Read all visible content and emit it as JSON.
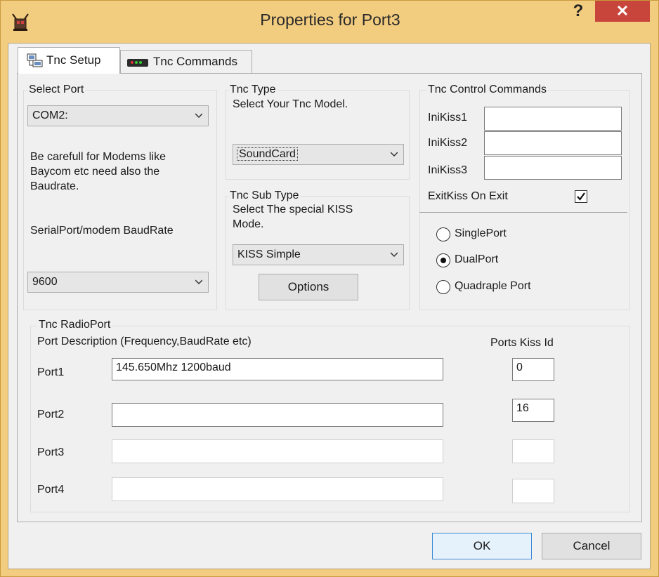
{
  "window": {
    "title": "Properties for Port3",
    "help_label": "?",
    "close_label": "✕",
    "frame_color": "#f2cc7f",
    "close_color": "#c7453b"
  },
  "tabs": [
    {
      "label": "Tnc Setup",
      "icon": "network-settings-icon",
      "selected": true
    },
    {
      "label": "Tnc Commands",
      "icon": "tnc-device-icon",
      "selected": false
    }
  ],
  "select_port": {
    "legend": "Select Port",
    "port_value": "COM2:",
    "note": [
      "Be carefull for Modems like",
      "Baycom etc need also the",
      "Baudrate."
    ],
    "baud_label": "SerialPort/modem BaudRate",
    "baud_value": "9600"
  },
  "tnc_type": {
    "legend": "Tnc Type",
    "prompt": "Select Your Tnc Model.",
    "value": "SoundCard"
  },
  "tnc_sub_type": {
    "legend": "Tnc Sub Type",
    "prompt": [
      "Select The special KISS",
      "Mode."
    ],
    "value": "KISS Simple",
    "options_button": "Options"
  },
  "tnc_control": {
    "legend": "Tnc Control Commands",
    "fields": [
      {
        "label": "IniKiss1",
        "value": ""
      },
      {
        "label": "IniKiss2",
        "value": ""
      },
      {
        "label": "IniKiss3",
        "value": ""
      }
    ],
    "exitkiss_label": "ExitKiss On Exit",
    "exitkiss_checked": true,
    "port_mode_options": [
      "SinglePort",
      "DualPort",
      "Quadraple Port"
    ],
    "port_mode_selected": "DualPort"
  },
  "radio_port": {
    "legend": "Tnc RadioPort",
    "desc_header": "Port Description (Frequency,BaudRate etc)",
    "kiss_header": "Ports Kiss Id",
    "ports": [
      {
        "label": "Port1",
        "description": "145.650Mhz 1200baud",
        "kiss_id": "0",
        "enabled": true
      },
      {
        "label": "Port2",
        "description": "",
        "kiss_id": "16",
        "enabled": true
      },
      {
        "label": "Port3",
        "description": "",
        "kiss_id": "",
        "enabled": false
      },
      {
        "label": "Port4",
        "description": "",
        "kiss_id": "",
        "enabled": false
      }
    ]
  },
  "footer": {
    "ok": "OK",
    "cancel": "Cancel"
  }
}
